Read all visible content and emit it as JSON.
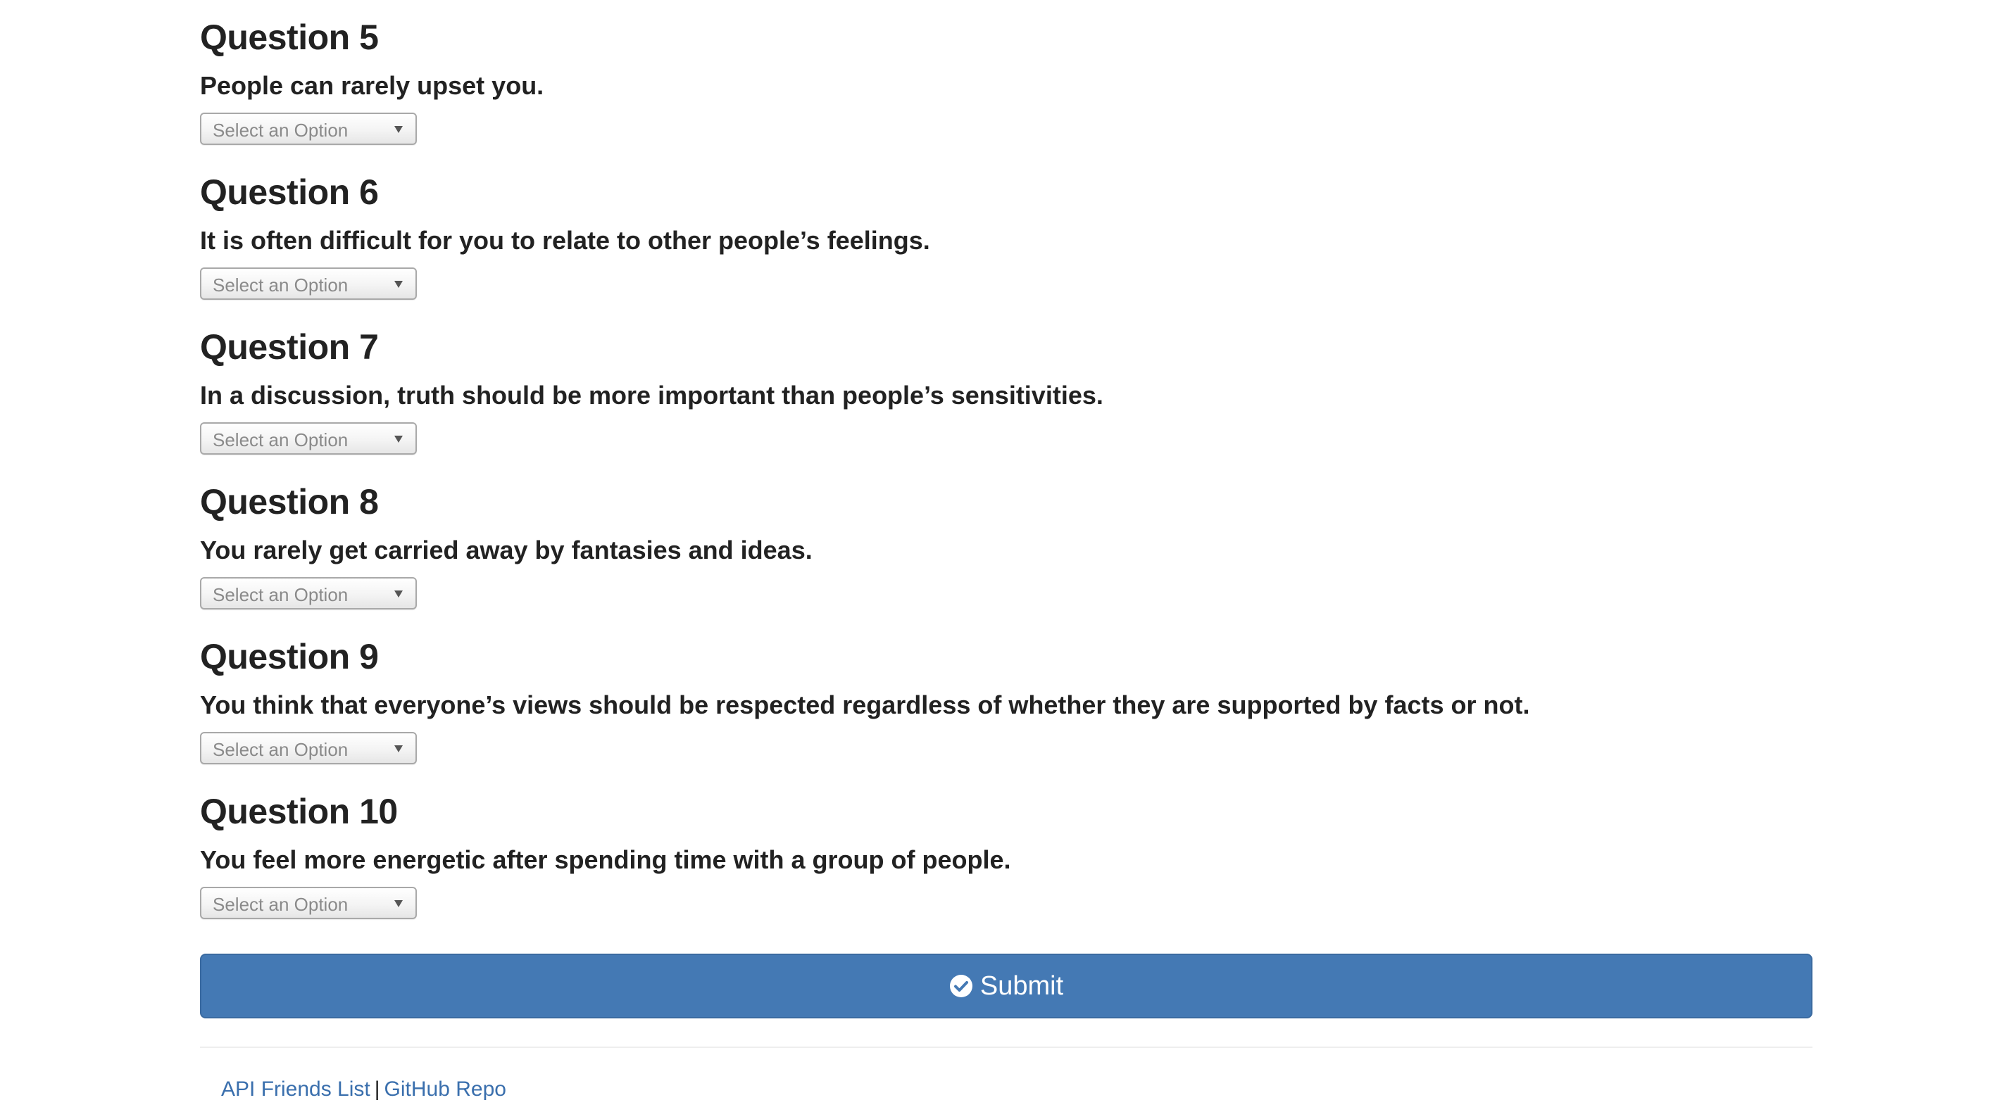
{
  "questions": [
    {
      "title": "Question 5",
      "text": "People can rarely upset you.",
      "select": "Select an Option"
    },
    {
      "title": "Question 6",
      "text": "It is often difficult for you to relate to other people’s feelings.",
      "select": "Select an Option"
    },
    {
      "title": "Question 7",
      "text": "In a discussion, truth should be more important than people’s sensitivities.",
      "select": "Select an Option"
    },
    {
      "title": "Question 8",
      "text": "You rarely get carried away by fantasies and ideas.",
      "select": "Select an Option"
    },
    {
      "title": "Question 9",
      "text": "You think that everyone’s views should be respected regardless of whether they are supported by facts or not.",
      "select": "Select an Option"
    },
    {
      "title": "Question 10",
      "text": "You feel more energetic after spending time with a group of people.",
      "select": "Select an Option"
    }
  ],
  "submit": {
    "label": "Submit",
    "icon": "check-circle-icon"
  },
  "footer": {
    "link1": "API Friends List",
    "separator": "|",
    "link2": "GitHub Repo"
  },
  "colors": {
    "primary": "#4479b4",
    "link": "#3a6fad",
    "text": "#222222"
  }
}
